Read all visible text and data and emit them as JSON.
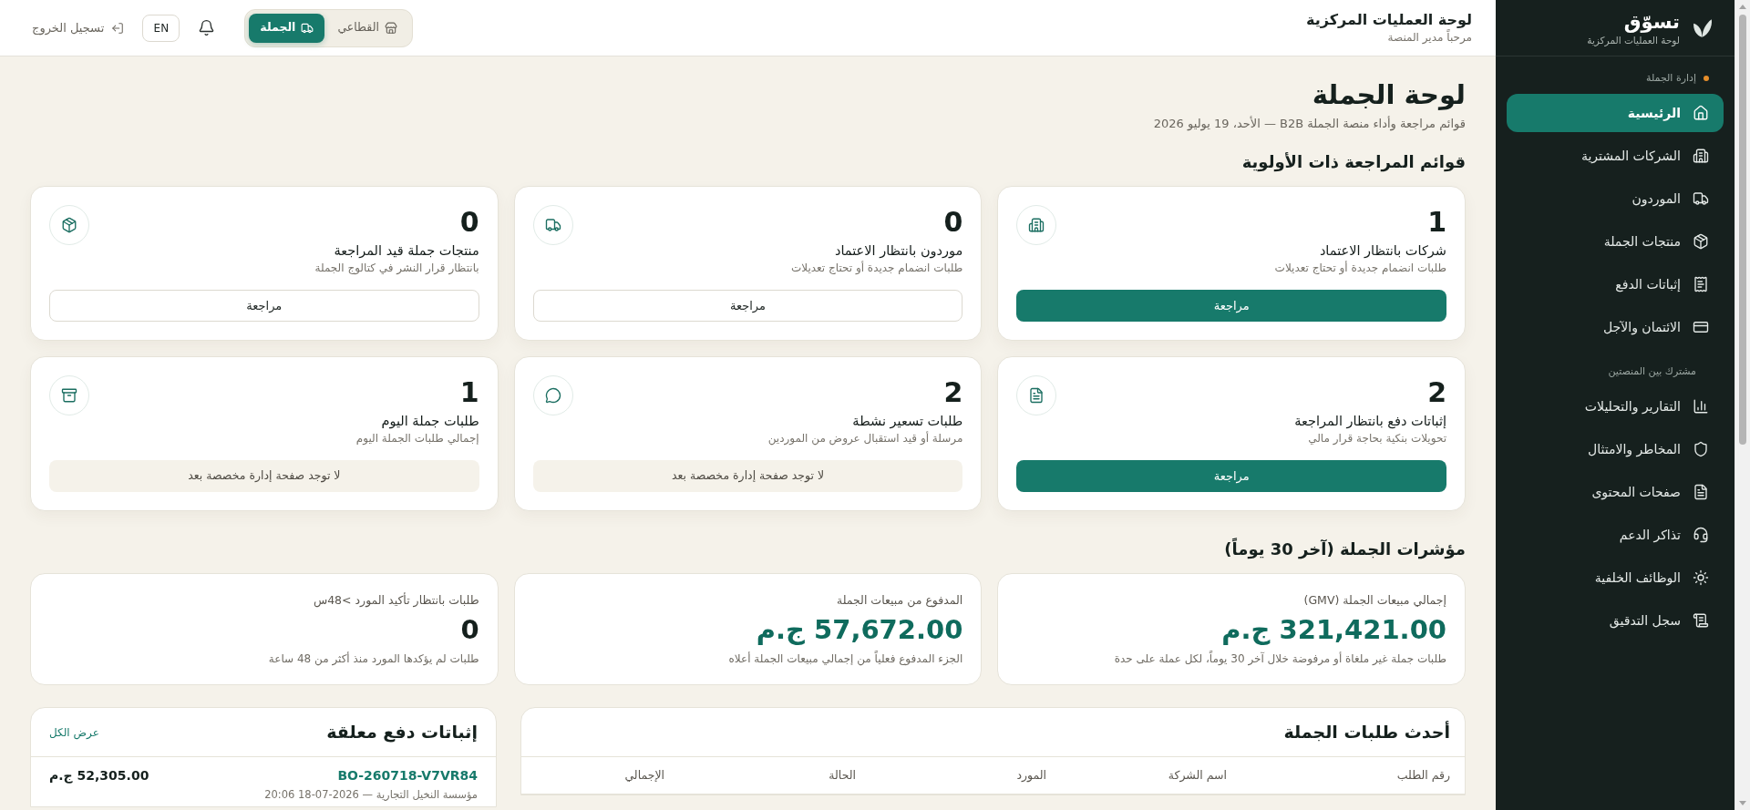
{
  "sidebar": {
    "brand": {
      "name": "تسوّق",
      "subtitle": "لوحة العمليات المركزية"
    },
    "sections": [
      {
        "label": "إدارة الجملة",
        "active": true,
        "items": [
          {
            "label": "الرئيسية",
            "selected": true
          },
          {
            "label": "الشركات المشترية",
            "selected": false
          },
          {
            "label": "الموردون",
            "selected": false
          },
          {
            "label": "منتجات الجملة",
            "selected": false
          },
          {
            "label": "إثباتات الدفع",
            "selected": false
          },
          {
            "label": "الائتمان والآجل",
            "selected": false
          }
        ]
      },
      {
        "label": "مشترك بين المنصتين",
        "active": false,
        "items": [
          {
            "label": "التقارير والتحليلات",
            "selected": false
          },
          {
            "label": "المخاطر والامتثال",
            "selected": false
          },
          {
            "label": "صفحات المحتوى",
            "selected": false
          },
          {
            "label": "تذاكر الدعم",
            "selected": false
          },
          {
            "label": "الوظائف الخلفية",
            "selected": false
          },
          {
            "label": "سجل التدقيق",
            "selected": false
          }
        ]
      }
    ]
  },
  "header": {
    "title": "لوحة العمليات المركزية",
    "subtitle": "مرحباً مدير المنصة",
    "mode_tabs": [
      {
        "label": "القطاعي",
        "selected": false
      },
      {
        "label": "الجملة",
        "selected": true
      }
    ],
    "language": "EN",
    "logout": "تسجيل الخروج"
  },
  "page": {
    "title": "لوحة الجملة",
    "subtitle": "قوائم مراجعة وأداء منصة الجملة B2B — الأحد، 19 يوليو 2026"
  },
  "review_queues": {
    "title": "قوائم المراجعة ذات الأولوية",
    "cards": [
      {
        "count": "1",
        "title": "شركات بانتظار الاعتماد",
        "subtitle": "طلبات انضمام جديدة أو تحتاج تعديلات",
        "action": {
          "kind": "primary",
          "label": "مراجعة"
        }
      },
      {
        "count": "0",
        "title": "موردون بانتظار الاعتماد",
        "subtitle": "طلبات انضمام جديدة أو تحتاج تعديلات",
        "action": {
          "kind": "secondary",
          "label": "مراجعة"
        }
      },
      {
        "count": "0",
        "title": "منتجات جملة قيد المراجعة",
        "subtitle": "بانتظار قرار النشر في كتالوج الجملة",
        "action": {
          "kind": "secondary",
          "label": "مراجعة"
        }
      },
      {
        "count": "2",
        "title": "إثباتات دفع بانتظار المراجعة",
        "subtitle": "تحويلات بنكية بحاجة قرار مالي",
        "action": {
          "kind": "primary",
          "label": "مراجعة"
        }
      },
      {
        "count": "2",
        "title": "طلبات تسعير نشطة",
        "subtitle": "مرسلة أو قيد استقبال عروض من الموردين",
        "action": {
          "kind": "unavailable",
          "label": "لا توجد صفحة إدارة مخصصة بعد"
        }
      },
      {
        "count": "1",
        "title": "طلبات جملة اليوم",
        "subtitle": "إجمالي طلبات الجملة اليوم",
        "action": {
          "kind": "unavailable",
          "label": "لا توجد صفحة إدارة مخصصة بعد"
        }
      }
    ]
  },
  "kpis": {
    "title": "مؤشرات الجملة (آخر 30 يوماً)",
    "cards": [
      {
        "kind": "money",
        "label": "إجمالي مبيعات الجملة (GMV)",
        "value": "321,421.00 ج.م",
        "note": "طلبات جملة غير ملغاة أو مرفوضة خلال آخر 30 يوماً، لكل عملة على حدة"
      },
      {
        "kind": "money",
        "label": "المدفوع من مبيعات الجملة",
        "value": "57,672.00 ج.م",
        "note": "الجزء المدفوع فعلياً من إجمالي مبيعات الجملة أعلاه"
      },
      {
        "kind": "count",
        "label": "طلبات بانتظار تأكيد المورد >48س",
        "value": "0",
        "note": "طلبات لم يؤكدها المورد منذ أكثر من 48 ساعة"
      }
    ]
  },
  "recent_orders": {
    "title": "أحدث طلبات الجملة",
    "columns": [
      "رقم الطلب",
      "اسم الشركة",
      "المورد",
      "الحالة",
      "الإجمالي"
    ]
  },
  "pending_payments": {
    "title": "إثباتات دفع معلقة",
    "link": "عرض الكل",
    "items": [
      {
        "reference": "BO-260718-V7VR84",
        "amount": "52,305.00 ج.م",
        "details": "مؤسسة النخيل التجارية — 2026-07-18 20:06"
      }
    ]
  }
}
